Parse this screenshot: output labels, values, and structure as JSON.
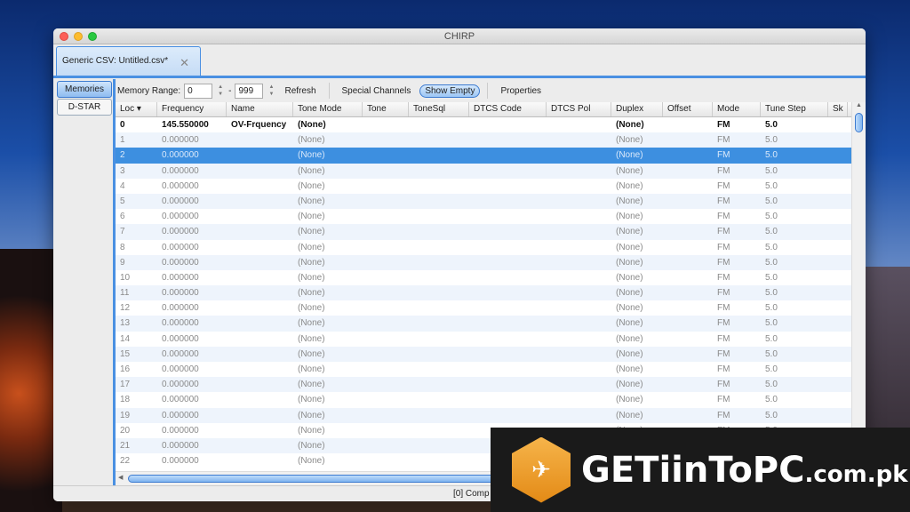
{
  "window": {
    "title": "CHIRP"
  },
  "tab": {
    "label": "Generic CSV: Untitled.csv*"
  },
  "side_tabs": [
    "Memories",
    "D-STAR"
  ],
  "toolbar": {
    "memory_range_label": "Memory Range:",
    "range_start": "0",
    "range_sep": "-",
    "range_end": "999",
    "refresh": "Refresh",
    "special_channels": "Special Channels",
    "show_empty": "Show Empty",
    "properties": "Properties"
  },
  "columns": [
    "Loc ▾",
    "Frequency",
    "Name",
    "Tone Mode",
    "Tone",
    "ToneSql",
    "DTCS Code",
    "DTCS Pol",
    "Duplex",
    "Offset",
    "Mode",
    "Tune Step",
    "Sk"
  ],
  "rows": [
    [
      "0",
      "145.550000",
      "OV-Frquency",
      "(None)",
      "",
      "",
      "",
      "",
      "(None)",
      "",
      "FM",
      "5.0",
      ""
    ],
    [
      "1",
      "0.000000",
      "",
      "(None)",
      "",
      "",
      "",
      "",
      "(None)",
      "",
      "FM",
      "5.0",
      ""
    ],
    [
      "2",
      "0.000000",
      "",
      "(None)",
      "",
      "",
      "",
      "",
      "(None)",
      "",
      "FM",
      "5.0",
      ""
    ],
    [
      "3",
      "0.000000",
      "",
      "(None)",
      "",
      "",
      "",
      "",
      "(None)",
      "",
      "FM",
      "5.0",
      ""
    ],
    [
      "4",
      "0.000000",
      "",
      "(None)",
      "",
      "",
      "",
      "",
      "(None)",
      "",
      "FM",
      "5.0",
      ""
    ],
    [
      "5",
      "0.000000",
      "",
      "(None)",
      "",
      "",
      "",
      "",
      "(None)",
      "",
      "FM",
      "5.0",
      ""
    ],
    [
      "6",
      "0.000000",
      "",
      "(None)",
      "",
      "",
      "",
      "",
      "(None)",
      "",
      "FM",
      "5.0",
      ""
    ],
    [
      "7",
      "0.000000",
      "",
      "(None)",
      "",
      "",
      "",
      "",
      "(None)",
      "",
      "FM",
      "5.0",
      ""
    ],
    [
      "8",
      "0.000000",
      "",
      "(None)",
      "",
      "",
      "",
      "",
      "(None)",
      "",
      "FM",
      "5.0",
      ""
    ],
    [
      "9",
      "0.000000",
      "",
      "(None)",
      "",
      "",
      "",
      "",
      "(None)",
      "",
      "FM",
      "5.0",
      ""
    ],
    [
      "10",
      "0.000000",
      "",
      "(None)",
      "",
      "",
      "",
      "",
      "(None)",
      "",
      "FM",
      "5.0",
      ""
    ],
    [
      "11",
      "0.000000",
      "",
      "(None)",
      "",
      "",
      "",
      "",
      "(None)",
      "",
      "FM",
      "5.0",
      ""
    ],
    [
      "12",
      "0.000000",
      "",
      "(None)",
      "",
      "",
      "",
      "",
      "(None)",
      "",
      "FM",
      "5.0",
      ""
    ],
    [
      "13",
      "0.000000",
      "",
      "(None)",
      "",
      "",
      "",
      "",
      "(None)",
      "",
      "FM",
      "5.0",
      ""
    ],
    [
      "14",
      "0.000000",
      "",
      "(None)",
      "",
      "",
      "",
      "",
      "(None)",
      "",
      "FM",
      "5.0",
      ""
    ],
    [
      "15",
      "0.000000",
      "",
      "(None)",
      "",
      "",
      "",
      "",
      "(None)",
      "",
      "FM",
      "5.0",
      ""
    ],
    [
      "16",
      "0.000000",
      "",
      "(None)",
      "",
      "",
      "",
      "",
      "(None)",
      "",
      "FM",
      "5.0",
      ""
    ],
    [
      "17",
      "0.000000",
      "",
      "(None)",
      "",
      "",
      "",
      "",
      "(None)",
      "",
      "FM",
      "5.0",
      ""
    ],
    [
      "18",
      "0.000000",
      "",
      "(None)",
      "",
      "",
      "",
      "",
      "(None)",
      "",
      "FM",
      "5.0",
      ""
    ],
    [
      "19",
      "0.000000",
      "",
      "(None)",
      "",
      "",
      "",
      "",
      "(None)",
      "",
      "FM",
      "5.0",
      ""
    ],
    [
      "20",
      "0.000000",
      "",
      "(None)",
      "",
      "",
      "",
      "",
      "(None)",
      "",
      "FM",
      "5.0",
      ""
    ],
    [
      "21",
      "0.000000",
      "",
      "(None)",
      "",
      "",
      "",
      "",
      "(None)",
      "",
      "FM",
      "5.0",
      ""
    ],
    [
      "22",
      "0.000000",
      "",
      "(None)",
      "",
      "",
      "",
      "",
      "(None)",
      "",
      "FM",
      "5.0",
      ""
    ]
  ],
  "selected_row": 2,
  "status": {
    "text": "[0] Comp"
  },
  "watermark": {
    "text": "GETiinToPC",
    "suffix": ".com.pk"
  },
  "colors": {
    "accent": "#4a90e2",
    "selection": "#3d8fe0",
    "alt_row": "#eef4fc"
  }
}
